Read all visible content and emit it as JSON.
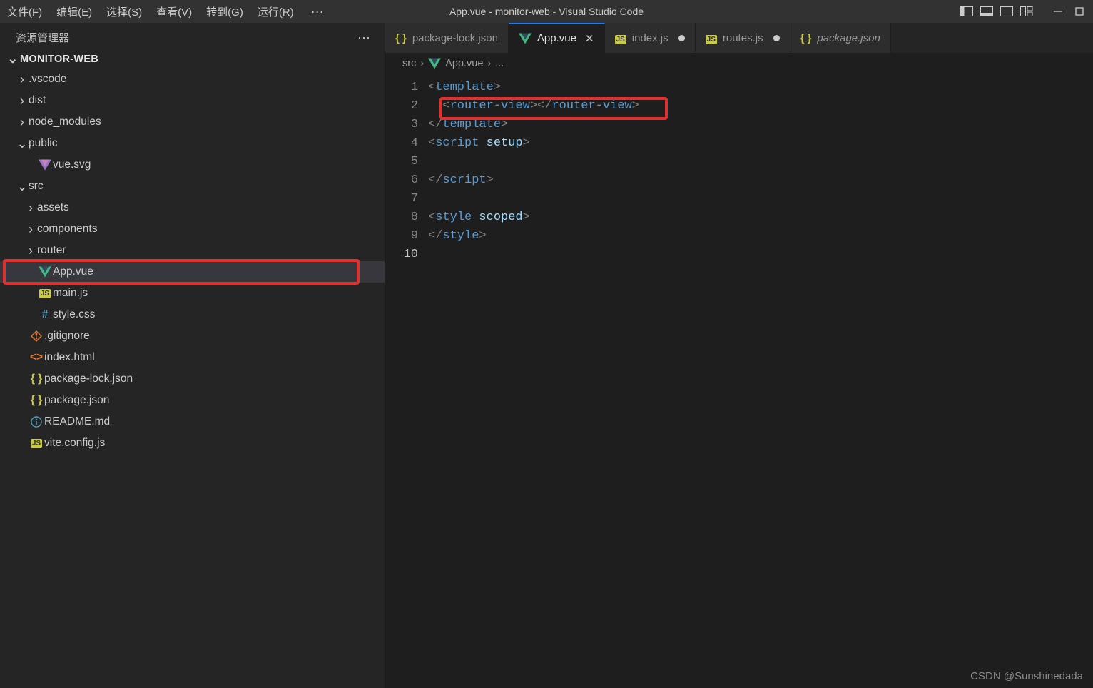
{
  "menubar": {
    "items": [
      "文件(F)",
      "编辑(E)",
      "选择(S)",
      "查看(V)",
      "转到(G)",
      "运行(R)"
    ],
    "more": "···",
    "title": "App.vue - monitor-web - Visual Studio Code"
  },
  "sidebar": {
    "title": "资源管理器",
    "more": "···",
    "project": "MONITOR-WEB",
    "tree": [
      {
        "depth": 1,
        "type": "folder",
        "open": false,
        "name": ".vscode"
      },
      {
        "depth": 1,
        "type": "folder",
        "open": false,
        "name": "dist"
      },
      {
        "depth": 1,
        "type": "folder",
        "open": false,
        "name": "node_modules"
      },
      {
        "depth": 1,
        "type": "folder",
        "open": true,
        "name": "public"
      },
      {
        "depth": 2,
        "type": "file",
        "icon": "vue-logo-red",
        "name": "vue.svg"
      },
      {
        "depth": 1,
        "type": "folder",
        "open": true,
        "name": "src"
      },
      {
        "depth": 2,
        "type": "folder",
        "open": false,
        "name": "assets"
      },
      {
        "depth": 2,
        "type": "folder",
        "open": false,
        "name": "components"
      },
      {
        "depth": 2,
        "type": "folder",
        "open": false,
        "name": "router"
      },
      {
        "depth": 2,
        "type": "file",
        "icon": "vue-logo-green",
        "name": "App.vue",
        "selected": true,
        "highlight": true
      },
      {
        "depth": 2,
        "type": "file",
        "icon": "js",
        "name": "main.js"
      },
      {
        "depth": 2,
        "type": "file",
        "icon": "hash",
        "name": "style.css"
      },
      {
        "depth": 1,
        "type": "file",
        "icon": "git",
        "name": ".gitignore"
      },
      {
        "depth": 1,
        "type": "file",
        "icon": "html",
        "name": "index.html"
      },
      {
        "depth": 1,
        "type": "file",
        "icon": "braces",
        "name": "package-lock.json"
      },
      {
        "depth": 1,
        "type": "file",
        "icon": "braces",
        "name": "package.json"
      },
      {
        "depth": 1,
        "type": "file",
        "icon": "info",
        "name": "README.md"
      },
      {
        "depth": 1,
        "type": "file",
        "icon": "js",
        "name": "vite.config.js"
      }
    ]
  },
  "tabs": [
    {
      "icon": "braces",
      "label": "package-lock.json",
      "active": false
    },
    {
      "icon": "vue-logo-green",
      "label": "App.vue",
      "active": true,
      "close": true
    },
    {
      "icon": "js",
      "label": "index.js",
      "active": false,
      "dirty": true
    },
    {
      "icon": "js",
      "label": "routes.js",
      "active": false,
      "dirty": true
    },
    {
      "icon": "braces",
      "label": "package.json",
      "active": false,
      "italic": true
    }
  ],
  "breadcrumb": {
    "parts": [
      "src",
      "App.vue",
      "..."
    ],
    "icon": "vue-logo-green"
  },
  "code": {
    "lines": [
      {
        "n": 1,
        "tokens": [
          [
            "p-gray",
            "<"
          ],
          [
            "p-tag",
            "template"
          ],
          [
            "p-gray",
            ">"
          ]
        ]
      },
      {
        "n": 2,
        "indent": 1,
        "hl": true,
        "tokens": [
          [
            "p-gray",
            "<"
          ],
          [
            "p-tag",
            "router-view"
          ],
          [
            "p-gray",
            "></"
          ],
          [
            "p-tag",
            "router-view"
          ],
          [
            "p-gray",
            ">"
          ]
        ]
      },
      {
        "n": 3,
        "tokens": [
          [
            "p-gray",
            "</"
          ],
          [
            "p-tag",
            "template"
          ],
          [
            "p-gray",
            ">"
          ]
        ]
      },
      {
        "n": 4,
        "tokens": [
          [
            "p-gray",
            "<"
          ],
          [
            "p-tag",
            "script"
          ],
          [
            "",
            " "
          ],
          [
            "p-attr",
            "setup"
          ],
          [
            "p-gray",
            ">"
          ]
        ]
      },
      {
        "n": 5,
        "tokens": []
      },
      {
        "n": 6,
        "tokens": [
          [
            "p-gray",
            "</"
          ],
          [
            "p-tag",
            "script"
          ],
          [
            "p-gray",
            ">"
          ]
        ]
      },
      {
        "n": 7,
        "tokens": []
      },
      {
        "n": 8,
        "tokens": [
          [
            "p-gray",
            "<"
          ],
          [
            "p-tag",
            "style"
          ],
          [
            "",
            " "
          ],
          [
            "p-attr",
            "scoped"
          ],
          [
            "p-gray",
            ">"
          ]
        ]
      },
      {
        "n": 9,
        "tokens": [
          [
            "p-gray",
            "</"
          ],
          [
            "p-tag",
            "style"
          ],
          [
            "p-gray",
            ">"
          ]
        ]
      },
      {
        "n": 10,
        "current": true,
        "tokens": []
      }
    ]
  },
  "watermark": "CSDN @Sunshinedada"
}
